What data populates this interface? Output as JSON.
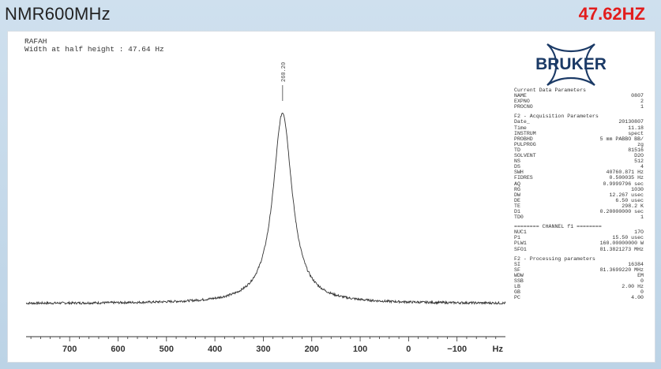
{
  "header": {
    "left_title": "NMR600MHz",
    "right_title": "47.62HZ"
  },
  "spectrum": {
    "sample_name": "RAFAH",
    "subtitle": "Width at half height : 47.64 Hz",
    "peak_label": "260.20",
    "brand": "BRUKER"
  },
  "params": {
    "header": "Current Data Parameters",
    "name": {
      "k": "NAME",
      "v": "0807"
    },
    "expno": {
      "k": "EXPNO",
      "v": "2"
    },
    "procno": {
      "k": "PROCNO",
      "v": "1"
    },
    "acq_title": "F2 - Acquisition Parameters",
    "acq": [
      {
        "k": "Date_",
        "v": "20130807"
      },
      {
        "k": "Time",
        "v": "11.18"
      },
      {
        "k": "INSTRUM",
        "v": "spect"
      },
      {
        "k": "PROBHD",
        "v": "5 mm PABBO BB/"
      },
      {
        "k": "PULPROG",
        "v": "zg"
      },
      {
        "k": "TD",
        "v": "81516"
      },
      {
        "k": "SOLVENT",
        "v": "D2O"
      },
      {
        "k": "NS",
        "v": "512"
      },
      {
        "k": "DS",
        "v": "4"
      },
      {
        "k": "SWH",
        "v": "40760.871 Hz"
      },
      {
        "k": "FIDRES",
        "v": "0.500035 Hz"
      },
      {
        "k": "AQ",
        "v": "0.9999796 sec"
      },
      {
        "k": "RG",
        "v": "1030"
      },
      {
        "k": "DW",
        "v": "12.267 usec"
      },
      {
        "k": "DE",
        "v": "6.50 usec"
      },
      {
        "k": "TE",
        "v": "298.2 K"
      },
      {
        "k": "D1",
        "v": "0.20000000 sec"
      },
      {
        "k": "TD0",
        "v": "1"
      }
    ],
    "channel_title": "======== CHANNEL f1 ========",
    "channel": [
      {
        "k": "NUC1",
        "v": "17O"
      },
      {
        "k": "P1",
        "v": "15.50 usec"
      },
      {
        "k": "PLW1",
        "v": "160.00000000 W"
      },
      {
        "k": "SFO1",
        "v": "81.3821273 MHz"
      }
    ],
    "proc_title": "F2 - Processing parameters",
    "proc": [
      {
        "k": "SI",
        "v": "16384"
      },
      {
        "k": "SF",
        "v": "81.3699220 MHz"
      },
      {
        "k": "WDW",
        "v": "EM"
      },
      {
        "k": "SSB",
        "v": "0"
      },
      {
        "k": "LB",
        "v": "2.00 Hz"
      },
      {
        "k": "GB",
        "v": "0"
      },
      {
        "k": "PC",
        "v": "4.00"
      }
    ]
  },
  "chart_data": {
    "type": "line",
    "title": "",
    "xlabel": "Hz",
    "ylabel": "",
    "xlim": [
      790,
      -200
    ],
    "x_reversed": true,
    "ticks": [
      700,
      600,
      500,
      400,
      300,
      200,
      100,
      0,
      -100
    ],
    "tick_labels": [
      "700",
      "600",
      "500",
      "400",
      "300",
      "200",
      "100",
      "0",
      "−100"
    ],
    "series": [
      {
        "peak_position": 260.2,
        "fwhm": 47.64,
        "peak_height_rel": 1.0,
        "baseline_rel": 0.0
      }
    ]
  },
  "colors": {
    "title_accent": "#e21d1d",
    "trace": "#333333",
    "background": "#ffffff",
    "logo": "#1b3a66"
  }
}
